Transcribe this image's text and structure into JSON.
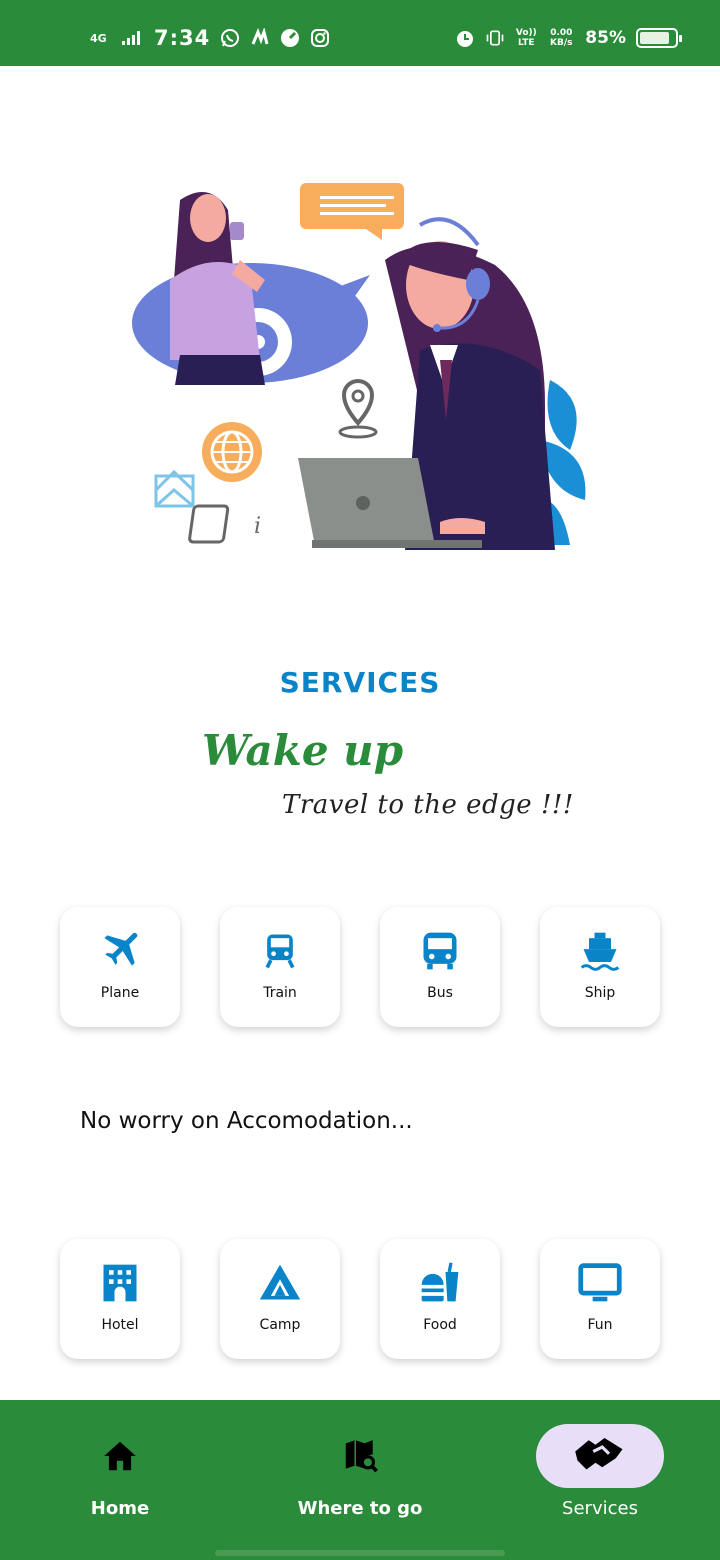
{
  "status_bar": {
    "network": "4G",
    "time": "7:34",
    "volte": "Vo)) LTE",
    "speed": "0.00 KB/s",
    "battery": "85%",
    "battery_level": 0.85,
    "icons": [
      "whatsapp-icon",
      "app-icon",
      "gauge-icon",
      "instagram-icon",
      "alarm-icon",
      "vibrate-icon"
    ]
  },
  "hero": {
    "illustration": "customer-support-illustration"
  },
  "header": {
    "title": "SERVICES",
    "tagline": "Wake up",
    "subline": "Travel to the edge  !!!"
  },
  "transport": {
    "items": [
      {
        "label": "Plane",
        "icon": "plane-icon"
      },
      {
        "label": "Train",
        "icon": "train-icon"
      },
      {
        "label": "Bus",
        "icon": "bus-icon"
      },
      {
        "label": "Ship",
        "icon": "ship-icon"
      }
    ]
  },
  "accommodation": {
    "title": "No worry on Accomodation...",
    "items": [
      {
        "label": "Hotel",
        "icon": "hotel-icon"
      },
      {
        "label": "Camp",
        "icon": "camp-icon"
      },
      {
        "label": "Food",
        "icon": "food-icon"
      },
      {
        "label": "Fun",
        "icon": "monitor-icon"
      }
    ]
  },
  "bottom_nav": {
    "items": [
      {
        "label": "Home",
        "icon": "home-icon",
        "active": false
      },
      {
        "label": "Where to go",
        "icon": "map-search-icon",
        "active": false
      },
      {
        "label": "Services",
        "icon": "handshake-icon",
        "active": true
      }
    ]
  },
  "colors": {
    "brand_green": "#2a8c3a",
    "accent_blue": "#0a84c8",
    "active_pill": "#e8def8"
  }
}
